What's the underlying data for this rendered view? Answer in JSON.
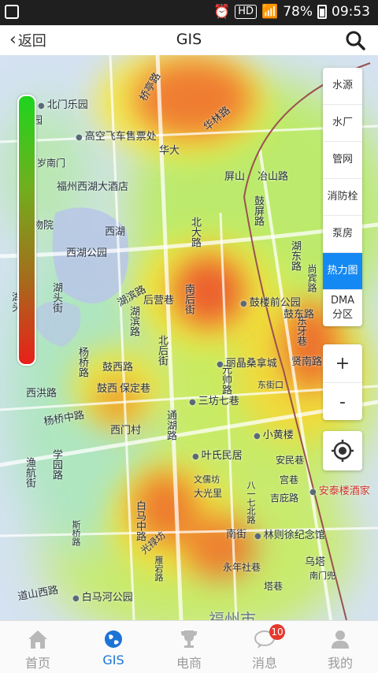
{
  "status_bar": {
    "hd": "HD",
    "battery": "78%",
    "time": "09:53"
  },
  "header": {
    "back_label": "返回",
    "title": "GIS"
  },
  "map_labels": [
    "北门乐园",
    "公园",
    "高空飞车售票处",
    "桥亭路",
    "华林路",
    "华大",
    "福州西湖大酒店",
    "物院",
    "西湖公园",
    "西湖",
    "湖头街",
    "湖滨路",
    "后营巷",
    "鼓楼前公园",
    "屏山",
    "冶山路",
    "鼓屏路",
    "北大路",
    "湖东路",
    "东牙巷",
    "贤南路",
    "丽晶桑拿城",
    "东街口",
    "三坊七巷",
    "鼓西路",
    "鼓西",
    "保定巷",
    "西洪路",
    "杨桥中路",
    "西门村",
    "小黄楼",
    "叶氏民居",
    "文儒坊",
    "大光里",
    "吉庇路",
    "安泰楼酒家",
    "南街",
    "林则徐纪念馆",
    "永年社巷",
    "乌塔",
    "南门兜",
    "白马河公园",
    "道山西路",
    "光禄坊",
    "塔巷",
    "安民巷",
    "宫巷",
    "八一七北路",
    "鼓东路",
    "元帅路",
    "通湖路",
    "湖滨路",
    "北后街",
    "南后街",
    "杨桥路",
    "学园路",
    "白马中路",
    "福州市",
    "渔航街",
    "万岁南门",
    "湖头",
    "尚宾路",
    "斯桥路",
    "雁宕路"
  ],
  "panel": {
    "buttons": [
      "水源",
      "水厂",
      "管网",
      "消防栓",
      "泵房",
      "热力图",
      "DMA 分区"
    ],
    "active": "热力图",
    "zoom_in": "+",
    "zoom_out": "-"
  },
  "tabs": [
    {
      "label": "首页",
      "icon": "home-icon"
    },
    {
      "label": "GIS",
      "icon": "globe-icon",
      "active": true
    },
    {
      "label": "电商",
      "icon": "trophy-icon"
    },
    {
      "label": "消息",
      "icon": "chat-icon",
      "badge": "10"
    },
    {
      "label": "我的",
      "icon": "user-icon"
    }
  ],
  "colors": {
    "accent": "#1589f3",
    "tab_active": "#1b73d6",
    "badge": "#e43a2e"
  }
}
